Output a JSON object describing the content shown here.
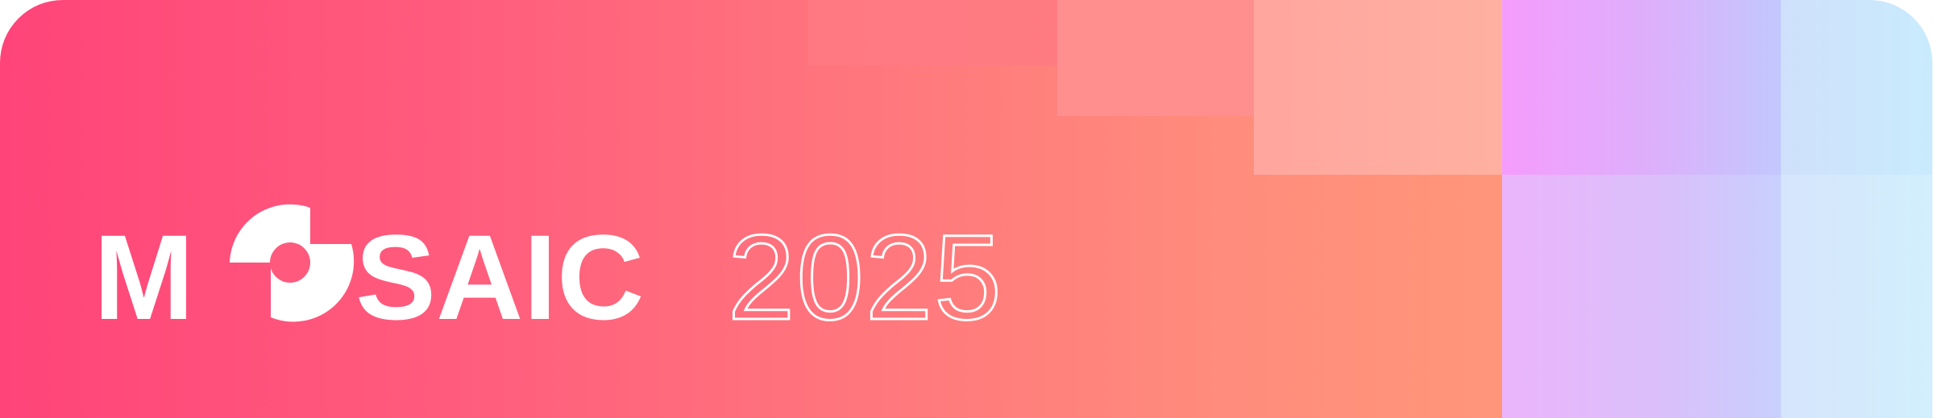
{
  "banner": {
    "logo": {
      "prefix": "M",
      "suffix": "SAIC",
      "year": "2025",
      "full_name": "MOSAIC 2025"
    },
    "colors": {
      "gradient_start": "#ff4479",
      "gradient_end": "#ff967a",
      "accent_purple": "#f59cfc",
      "accent_blue": "#c9ebfd",
      "text": "#ffffff"
    }
  }
}
